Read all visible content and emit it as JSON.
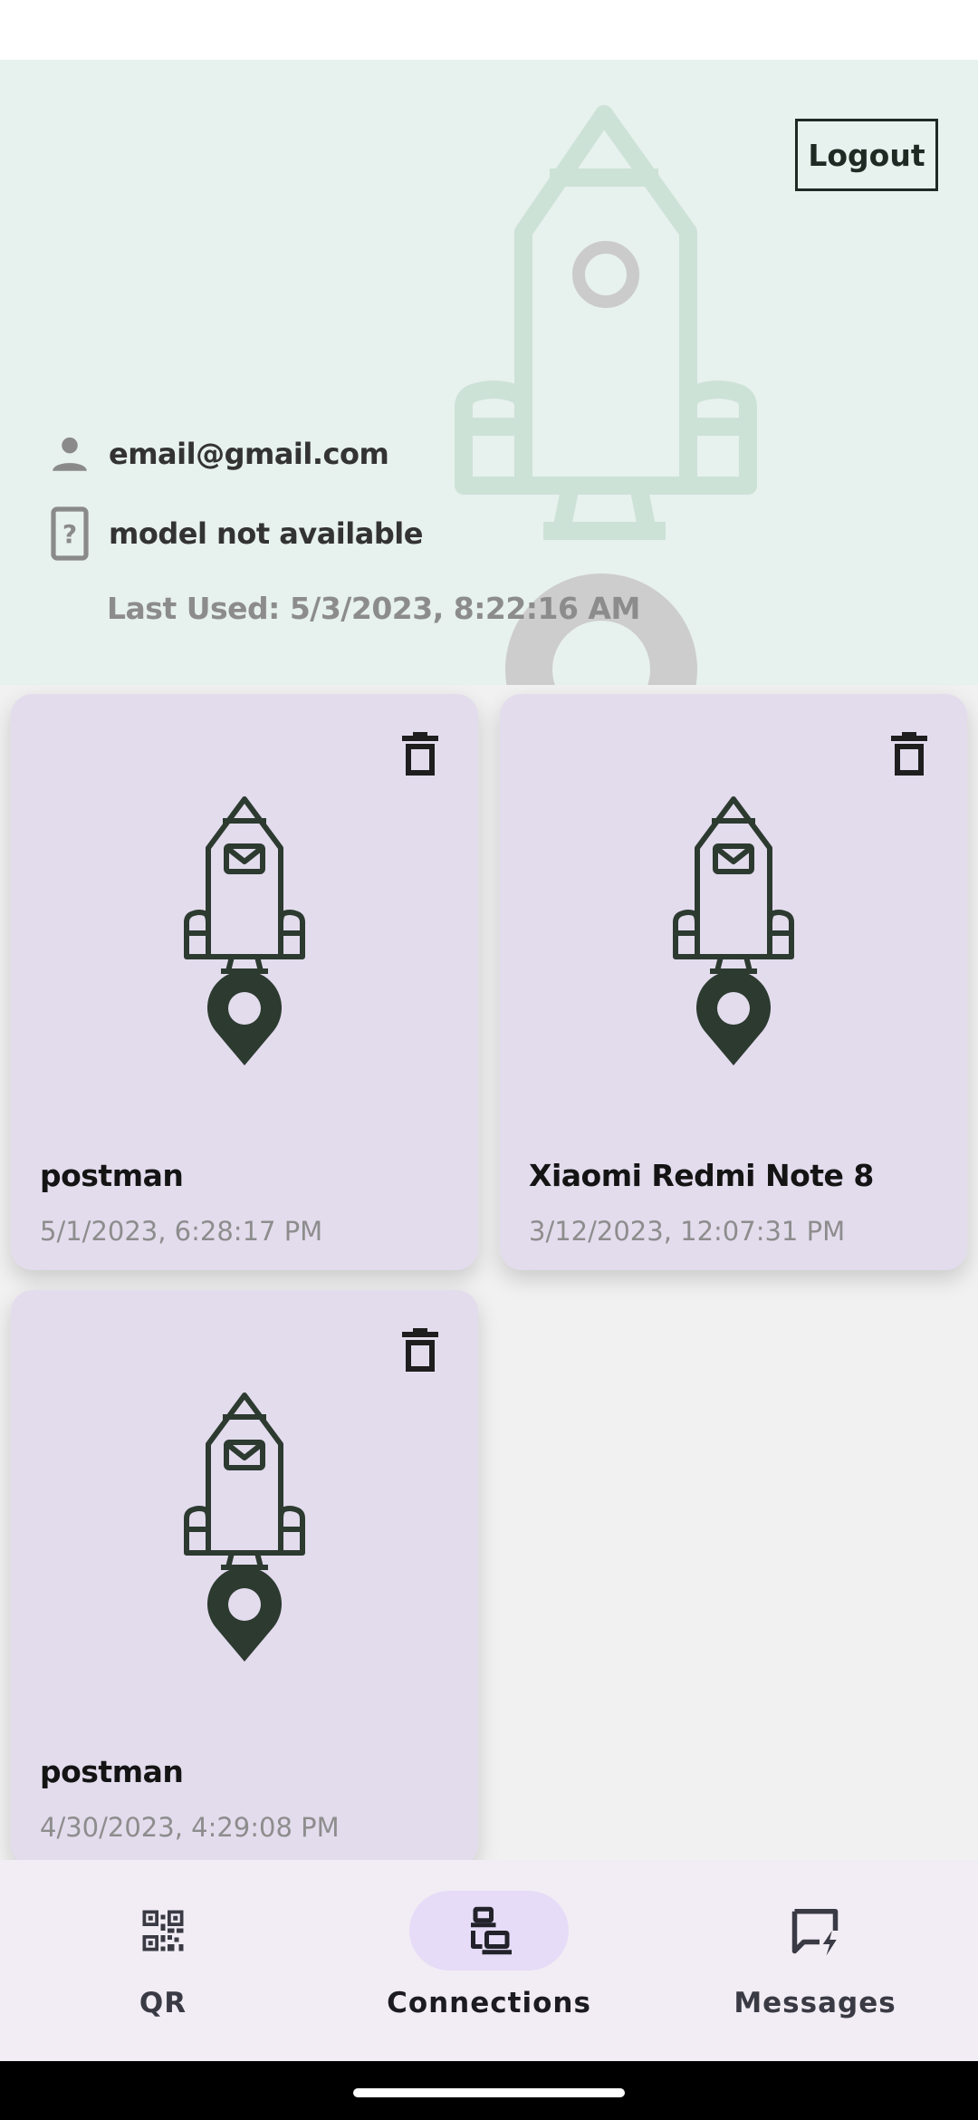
{
  "header": {
    "logout_label": "Logout",
    "email": "email@gmail.com",
    "model": "model not available",
    "last_used": "Last Used: 5/3/2023, 8:22:16 AM"
  },
  "connections": [
    {
      "name": "postman",
      "date": "5/1/2023, 6:28:17 PM"
    },
    {
      "name": "Xiaomi Redmi Note 8",
      "date": "3/12/2023, 12:07:31 PM"
    },
    {
      "name": "postman",
      "date": "4/30/2023, 4:29:08 PM"
    }
  ],
  "bottom_nav": {
    "items": [
      {
        "label": "QR",
        "icon": "qr-code-icon",
        "active": false
      },
      {
        "label": "Connections",
        "icon": "devices-icon",
        "active": true
      },
      {
        "label": "Messages",
        "icon": "message-alert-icon",
        "active": false
      }
    ]
  },
  "colors": {
    "header_bg": "#e7f1ee",
    "card_bg": "#e3dced",
    "rocket_dark": "#2c3a30",
    "nav_bg": "#f2edf4",
    "nav_active_pill": "#e6dcf7"
  }
}
